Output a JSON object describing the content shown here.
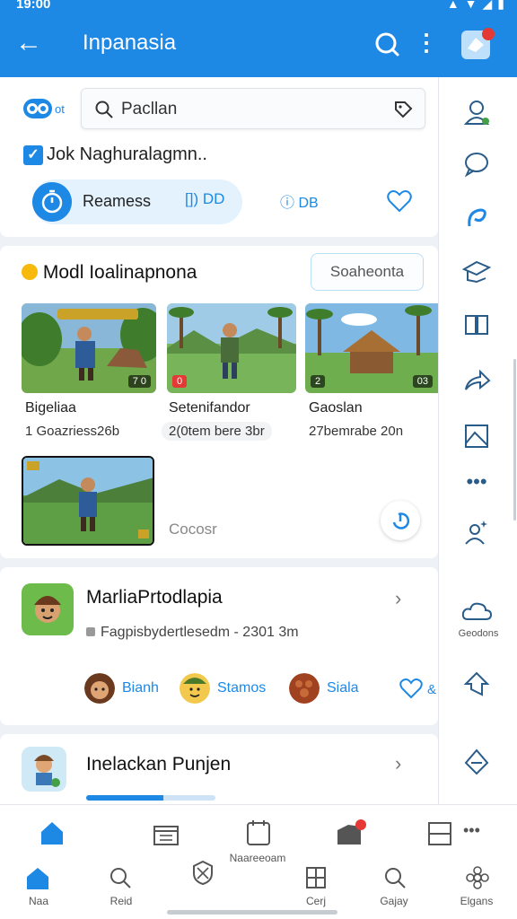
{
  "status_bar": {
    "time": "19:00"
  },
  "app_bar": {
    "title": "Inpanasia"
  },
  "filter": {
    "toggle_label": "ot",
    "search_value": "Pacllan",
    "checkbox_label": "Jok Naghuralagmn..",
    "pill_label": "Reamess",
    "pill_sub": "[]) DD",
    "db_label": "DB"
  },
  "section": {
    "title": "Modl Ioalinapnona",
    "button_label": "Soaheonta",
    "items": [
      {
        "title": "Bigeliaa",
        "sub": "1 Goazriess26b",
        "chip_left": "",
        "chip_right": "7 0"
      },
      {
        "title": "Setenifandor",
        "sub": "2(0tem bere 3br",
        "chip_left": "0",
        "chip_right": ""
      },
      {
        "title": "Gaoslan",
        "sub": "27bemrabe 20n",
        "chip_left": "2",
        "chip_right": "03"
      }
    ],
    "more_label": "Cocosr"
  },
  "app1": {
    "name": "MarliaPrtodlapia",
    "meta": "Fagpisbydertlesedm - 2301 3m",
    "friends": [
      "Bianh",
      "Stamos",
      "Siala"
    ],
    "extra": "&"
  },
  "app2": {
    "name": "Inelackan Punjen",
    "progress": 0.6
  },
  "rail": {
    "cloud_label": "Geodons"
  },
  "bottom_nav": {
    "top_label": "Naareeoam",
    "items": [
      "Naa",
      "Reid",
      "",
      "Cerj",
      "Gajay",
      "Elgans"
    ]
  },
  "colors": {
    "accent": "#1e88e5",
    "badge": "#e53935"
  }
}
